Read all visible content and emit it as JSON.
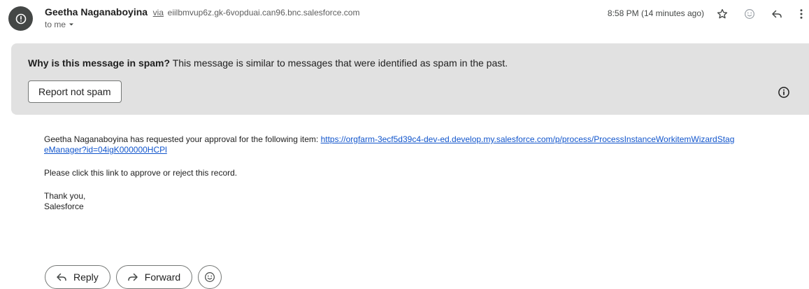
{
  "sender": {
    "name": "Geetha Naganaboyina",
    "via_label": "via",
    "address": "eiilbmvup6z.gk-6vopduai.can96.bnc.salesforce.com",
    "to_label": "to me"
  },
  "header": {
    "timestamp": "8:58 PM (14 minutes ago)"
  },
  "spam_banner": {
    "question": "Why is this message in spam?",
    "explanation": "This message is similar to messages that were identified as spam in the past.",
    "report_button": "Report not spam"
  },
  "message": {
    "intro": "Geetha Naganaboyina has requested your approval for the following item:",
    "link": "https://orgfarm-3ecf5d39c4-dev-ed.develop.my.salesforce.com/p/process/ProcessInstanceWorkitemWizardStageManager?id=04igK000000HCPl",
    "instruction": "Please click this link to approve or reject this record.",
    "closing": "Thank you,",
    "signature": "Salesforce"
  },
  "actions": {
    "reply_label": "Reply",
    "forward_label": "Forward"
  },
  "icons": {
    "avatar": "spam-alert-icon",
    "star": "star-icon",
    "emoji": "emoji-icon",
    "reply": "reply-icon",
    "more": "more-vert-icon",
    "info": "info-icon",
    "forward": "forward-icon",
    "dropdown": "chevron-down-icon"
  }
}
